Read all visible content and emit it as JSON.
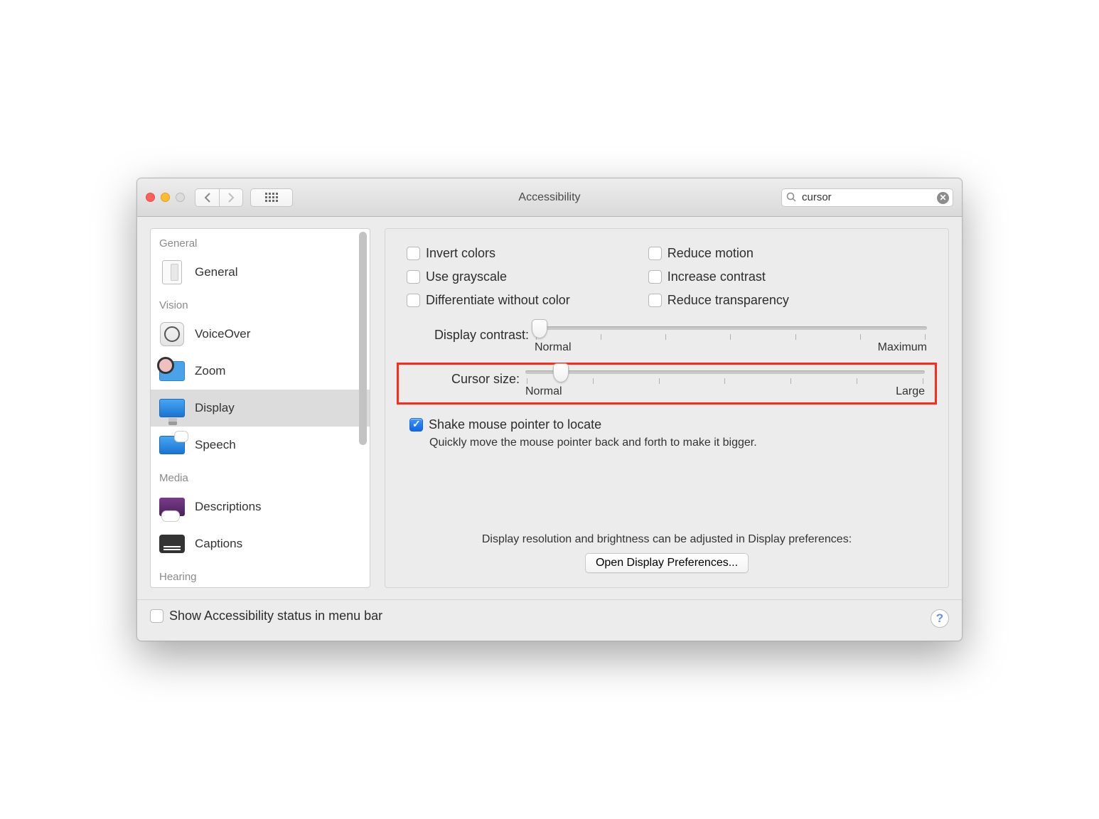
{
  "window": {
    "title": "Accessibility"
  },
  "search": {
    "value": "cursor"
  },
  "sidebar": {
    "sections": [
      {
        "header": "General",
        "items": [
          {
            "label": "General"
          }
        ]
      },
      {
        "header": "Vision",
        "items": [
          {
            "label": "VoiceOver"
          },
          {
            "label": "Zoom"
          },
          {
            "label": "Display"
          },
          {
            "label": "Speech"
          }
        ]
      },
      {
        "header": "Media",
        "items": [
          {
            "label": "Descriptions"
          },
          {
            "label": "Captions"
          }
        ]
      },
      {
        "header": "Hearing",
        "items": []
      }
    ]
  },
  "checkboxes": {
    "col1": [
      {
        "label": "Invert colors",
        "checked": false
      },
      {
        "label": "Use grayscale",
        "checked": false
      },
      {
        "label": "Differentiate without color",
        "checked": false
      }
    ],
    "col2": [
      {
        "label": "Reduce motion",
        "checked": false
      },
      {
        "label": "Increase contrast",
        "checked": false
      },
      {
        "label": "Reduce transparency",
        "checked": false
      }
    ]
  },
  "sliders": {
    "contrast": {
      "label": "Display contrast:",
      "min_label": "Normal",
      "max_label": "Maximum",
      "value_pct": 0
    },
    "cursor": {
      "label": "Cursor size:",
      "min_label": "Normal",
      "max_label": "Large",
      "value_pct": 7
    }
  },
  "shake": {
    "label": "Shake mouse pointer to locate",
    "checked": true,
    "desc": "Quickly move the mouse pointer back and forth to make it bigger."
  },
  "footer": {
    "note": "Display resolution and brightness can be adjusted in Display preferences:",
    "open_label": "Open Display Preferences..."
  },
  "bottom": {
    "status_label": "Show Accessibility status in menu bar",
    "status_checked": false
  }
}
